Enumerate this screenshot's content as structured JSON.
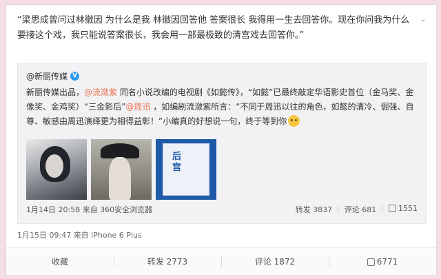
{
  "post": {
    "text": "“梁思成曾问过林徽因 为什么是我 林徽因回答他 答案很长 我得用一生去回答你。现在你问我为什么要接这个戏，我只能说答案很长，我会用一部最极致的清宫戏去回答你。”",
    "meta": "1月15日 09:47 来自 iPhone 6 Plus"
  },
  "repost": {
    "author": "@新丽传媒",
    "verified_badge": "V",
    "text_parts": {
      "p1": "新丽传媒出品，",
      "m1": "@流潋紫",
      "p2": " 同名小说改编的电视剧《如懿传》，“如懿”已最终敲定华语影史首位（金马奖、金像奖、金鸡奖）“三金影后”",
      "m2": "@周迅",
      "p3": " ，如编剧流潋紫所言：“不同于周迅以往的角色，如懿的清冷、倔强、自尊、敏感由周迅演绎更为相得益彰！”小编真的好想说一句，终于等到你"
    },
    "thumb3_title": "后宫",
    "meta": "1月14日 20:58 来自 360安全浏览器",
    "stats": {
      "forward": "转发 3837",
      "comment": "评论 681",
      "like": "1551"
    }
  },
  "actions": {
    "collect": "收藏",
    "forward": "转发 2773",
    "comment": "评论 1872",
    "like": "6771"
  },
  "icons": [
    "chevron-down-icon",
    "verified-icon",
    "cry-emoji-icon",
    "thumbs-up-icon"
  ],
  "colors": {
    "mention": "#eb7350",
    "background": "#f4dde7",
    "verified": "#2d9bf0"
  }
}
